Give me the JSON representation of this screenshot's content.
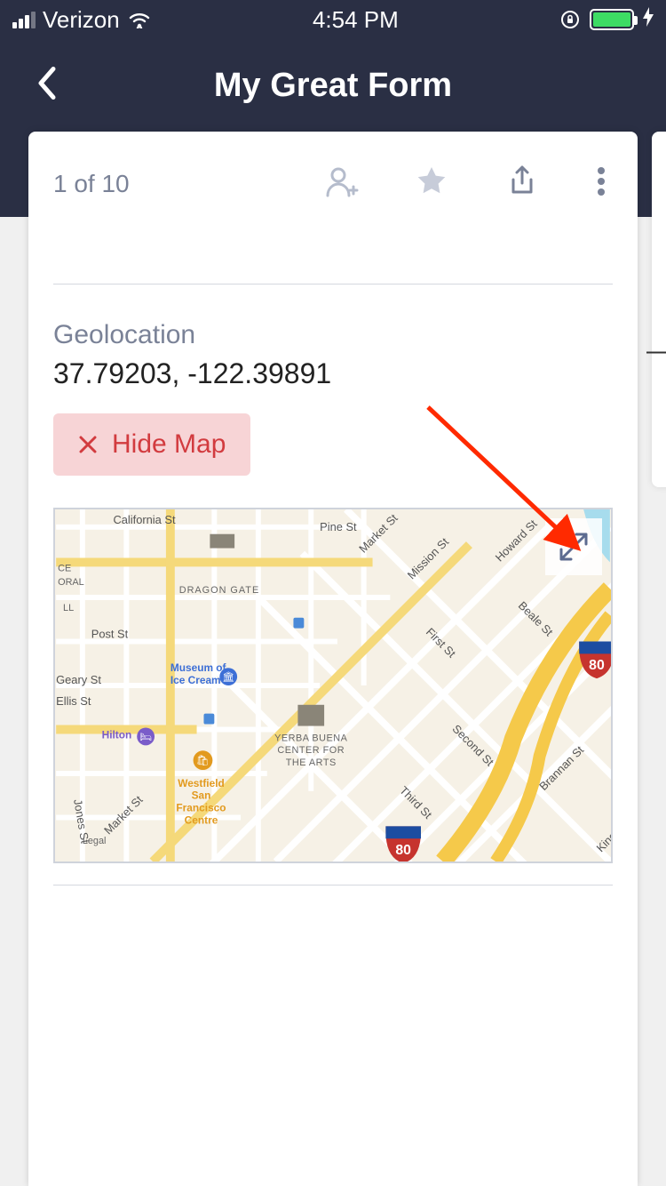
{
  "status_bar": {
    "carrier": "Verizon",
    "time": "4:54 PM"
  },
  "nav": {
    "title": "My Great Form"
  },
  "card": {
    "page_indicator": "1 of 10"
  },
  "geolocation": {
    "label": "Geolocation",
    "value": "37.79203, -122.39891",
    "hide_map_label": "Hide Map"
  },
  "map": {
    "labels": {
      "california": "California St",
      "pine": "Pine St",
      "market": "Market St",
      "mission": "Mission St",
      "howard": "Howard St",
      "first": "First St",
      "second": "Second St",
      "third": "Third St",
      "beale": "Beale St",
      "brannan": "Brannan St",
      "post": "Post St",
      "geary": "Geary St",
      "ellis": "Ellis St",
      "jones": "Jones St",
      "king": "King St",
      "dragon_gate": "DRAGON GATE",
      "legal": "Legal",
      "oral": "ORAL",
      "ce": "CE",
      "ll": "LL",
      "highway": "80"
    },
    "pois": {
      "museum_ice_cream_1": "Museum of",
      "museum_ice_cream_2": "Ice Cream",
      "hilton": "Hilton",
      "westfield_1": "Westfield",
      "westfield_2": "San",
      "westfield_3": "Francisco",
      "westfield_4": "Centre",
      "yerba_1": "YERBA BUENA",
      "yerba_2": "CENTER FOR",
      "yerba_3": "THE ARTS"
    }
  }
}
